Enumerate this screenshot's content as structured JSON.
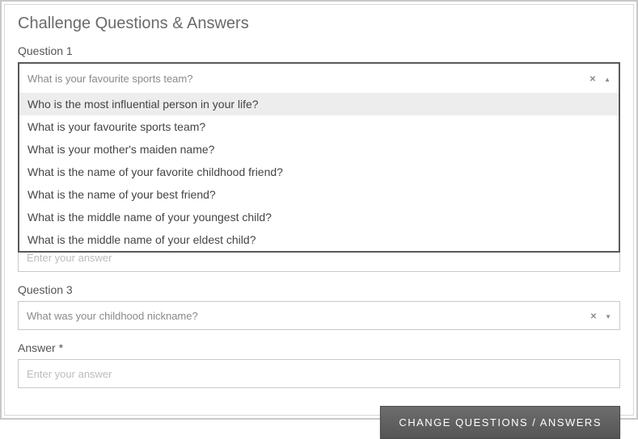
{
  "title": "Challenge Questions & Answers",
  "q1": {
    "label": "Question 1",
    "selected": "What is your favourite sports team?",
    "options": [
      "Who is the most influential person in your life?",
      "What is your favourite sports team?",
      "What is your mother's maiden name?",
      "What is the name of your favorite childhood friend?",
      "What is the name of your best friend?",
      "What is the middle name of your youngest child?",
      "What is the middle name of your eldest child?"
    ],
    "highlight_index": 0
  },
  "answer_partial_placeholder": "Enter your answer",
  "q3": {
    "label": "Question 3",
    "selected": "What was your childhood nickname?"
  },
  "answer": {
    "label": "Answer *",
    "placeholder": "Enter your answer",
    "value": ""
  },
  "submit_label": "CHANGE QUESTIONS / ANSWERS"
}
